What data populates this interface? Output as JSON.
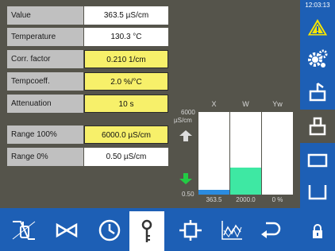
{
  "params": [
    {
      "label": "Value",
      "value": "363.5 µS/cm",
      "style": "white"
    },
    {
      "label": "Temperature",
      "value": "130.3 °C",
      "style": "white"
    },
    {
      "label": "Corr. factor",
      "value": "0.210 1/cm",
      "style": "yellow"
    },
    {
      "label": "Tempcoeff.",
      "value": "2.0 %/°C",
      "style": "yellow"
    },
    {
      "label": "Attenuation",
      "value": "10 s",
      "style": "yellow"
    },
    {
      "label": "Range 100%",
      "value": "6000.0 µS/cm",
      "style": "yellow"
    },
    {
      "label": "Range 0%",
      "value": "0.50 µS/cm",
      "style": "white"
    }
  ],
  "chart_data": {
    "type": "bar",
    "y_max_label": "6000",
    "y_unit": "µS/cm",
    "y_min_label": "0.50",
    "columns": [
      {
        "name": "X",
        "value_label": "363.5",
        "fill_fraction": 0.06,
        "color": "#2a8be0"
      },
      {
        "name": "W",
        "value_label": "2000.0",
        "fill_fraction": 0.33,
        "color": "#3ee8a3"
      },
      {
        "name": "Yw",
        "value_label": "0 %",
        "fill_fraction": 0.0,
        "color": "#2a8be0"
      }
    ],
    "upper_marker_color": "#dddddd",
    "lower_marker_color": "#22cc44"
  },
  "status": {
    "time": "12:03:13"
  },
  "colors": {
    "accent": "#1d5fb5",
    "panel": "#55544b",
    "warning": "#f7e600",
    "yellow_field": "#f7f06a"
  },
  "right_buttons": [
    "warning-icon",
    "gears-icon",
    "gripper-open-icon",
    "gripper-closed-icon",
    "rectangle-icon",
    "bracket-icon",
    "lock-icon"
  ],
  "bottom_buttons": [
    "hand-control-icon",
    "valve-icon",
    "clock-icon",
    "key-icon",
    "actuator-icon",
    "trend-chart-icon",
    "return-icon"
  ]
}
